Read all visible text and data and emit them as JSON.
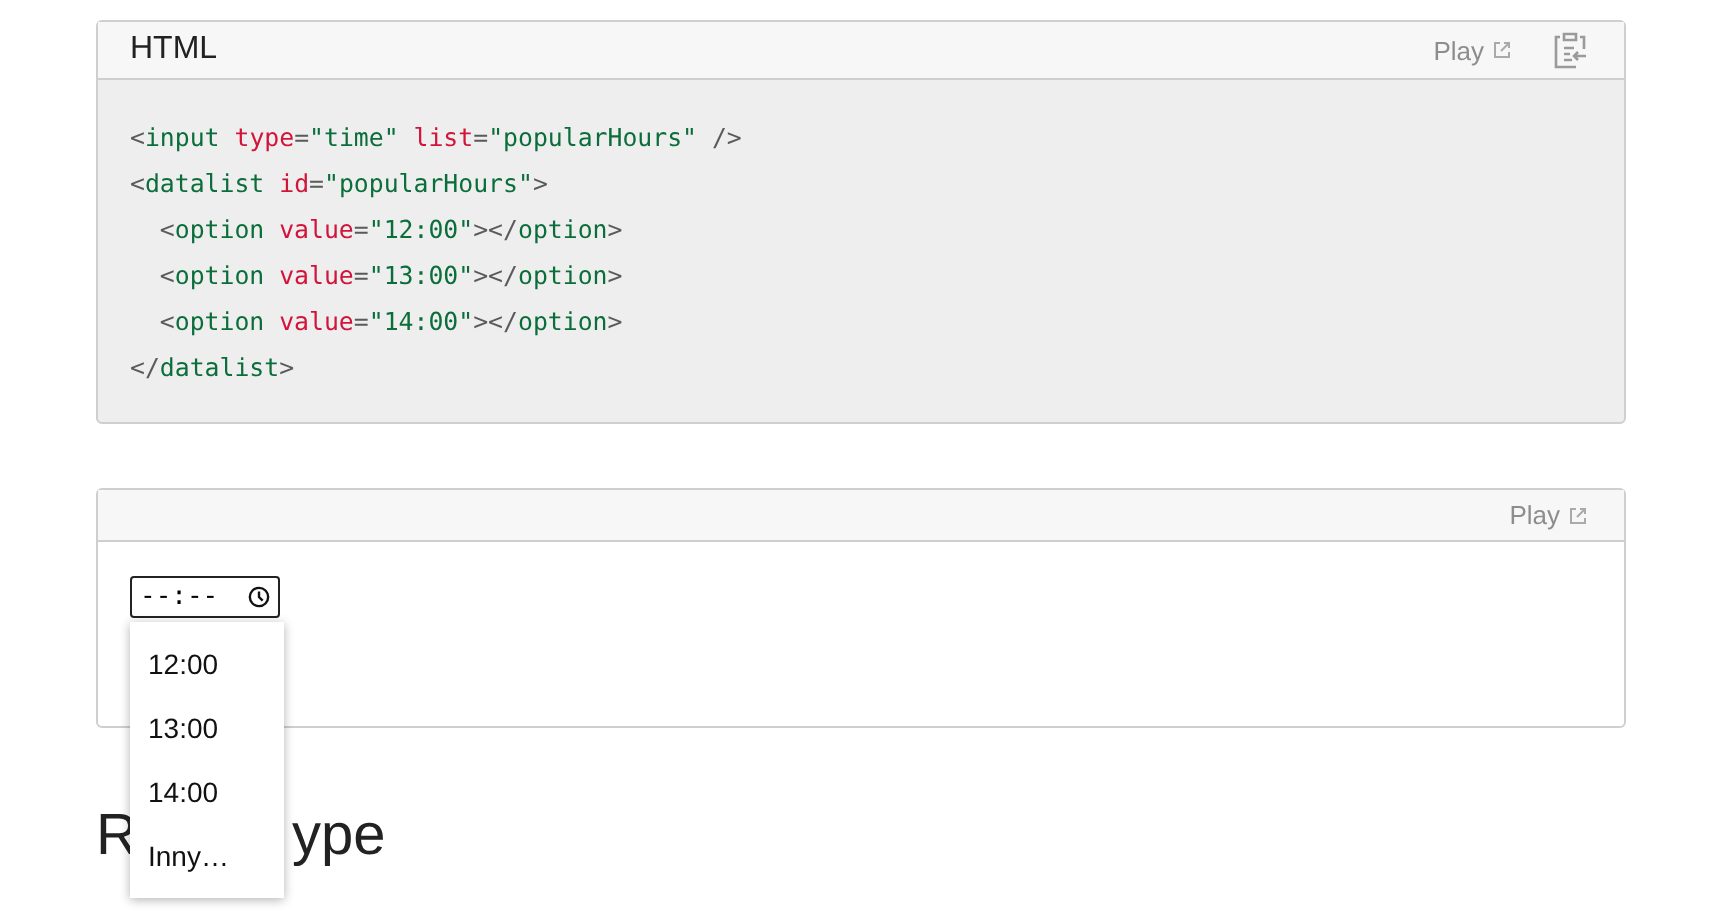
{
  "code_block": {
    "language": "HTML",
    "play_label": "Play",
    "lines": [
      {
        "tokens": [
          {
            "kind": "punct",
            "text": "<"
          },
          {
            "kind": "tag",
            "text": "input "
          },
          {
            "kind": "attr",
            "text": "type"
          },
          {
            "kind": "punct",
            "text": "="
          },
          {
            "kind": "str",
            "text": "\"time\" "
          },
          {
            "kind": "attr",
            "text": "list"
          },
          {
            "kind": "punct",
            "text": "="
          },
          {
            "kind": "str",
            "text": "\"popularHours\""
          },
          {
            "kind": "punct",
            "text": " />"
          }
        ]
      },
      {
        "tokens": [
          {
            "kind": "punct",
            "text": "<"
          },
          {
            "kind": "tag",
            "text": "datalist "
          },
          {
            "kind": "attr",
            "text": "id"
          },
          {
            "kind": "punct",
            "text": "="
          },
          {
            "kind": "str",
            "text": "\"popularHours\""
          },
          {
            "kind": "punct",
            "text": ">"
          }
        ],
        "children": [
          {
            "tokens": [
              {
                "kind": "punct",
                "text": "<"
              },
              {
                "kind": "tag",
                "text": "option "
              },
              {
                "kind": "attr",
                "text": "value"
              },
              {
                "kind": "punct",
                "text": "="
              },
              {
                "kind": "str",
                "text": "\"12:00\""
              },
              {
                "kind": "punct",
                "text": "></"
              },
              {
                "kind": "tag",
                "text": "option"
              },
              {
                "kind": "punct",
                "text": ">"
              }
            ]
          },
          {
            "tokens": [
              {
                "kind": "punct",
                "text": "<"
              },
              {
                "kind": "tag",
                "text": "option "
              },
              {
                "kind": "attr",
                "text": "value"
              },
              {
                "kind": "punct",
                "text": "="
              },
              {
                "kind": "str",
                "text": "\"13:00\""
              },
              {
                "kind": "punct",
                "text": "></"
              },
              {
                "kind": "tag",
                "text": "option"
              },
              {
                "kind": "punct",
                "text": ">"
              }
            ]
          },
          {
            "tokens": [
              {
                "kind": "punct",
                "text": "<"
              },
              {
                "kind": "tag",
                "text": "option "
              },
              {
                "kind": "attr",
                "text": "value"
              },
              {
                "kind": "punct",
                "text": "="
              },
              {
                "kind": "str",
                "text": "\"14:00\""
              },
              {
                "kind": "punct",
                "text": "></"
              },
              {
                "kind": "tag",
                "text": "option"
              },
              {
                "kind": "punct",
                "text": ">"
              }
            ]
          }
        ]
      },
      {
        "tokens": [
          {
            "kind": "punct",
            "text": "</"
          },
          {
            "kind": "tag",
            "text": "datalist"
          },
          {
            "kind": "punct",
            "text": ">"
          }
        ]
      }
    ]
  },
  "demo": {
    "play_label": "Play",
    "time_input": {
      "value": "--:--"
    },
    "dropdown": [
      "12:00",
      "13:00",
      "14:00",
      "Inny…"
    ]
  },
  "heading": {
    "start": "R",
    "end": "ype"
  }
}
